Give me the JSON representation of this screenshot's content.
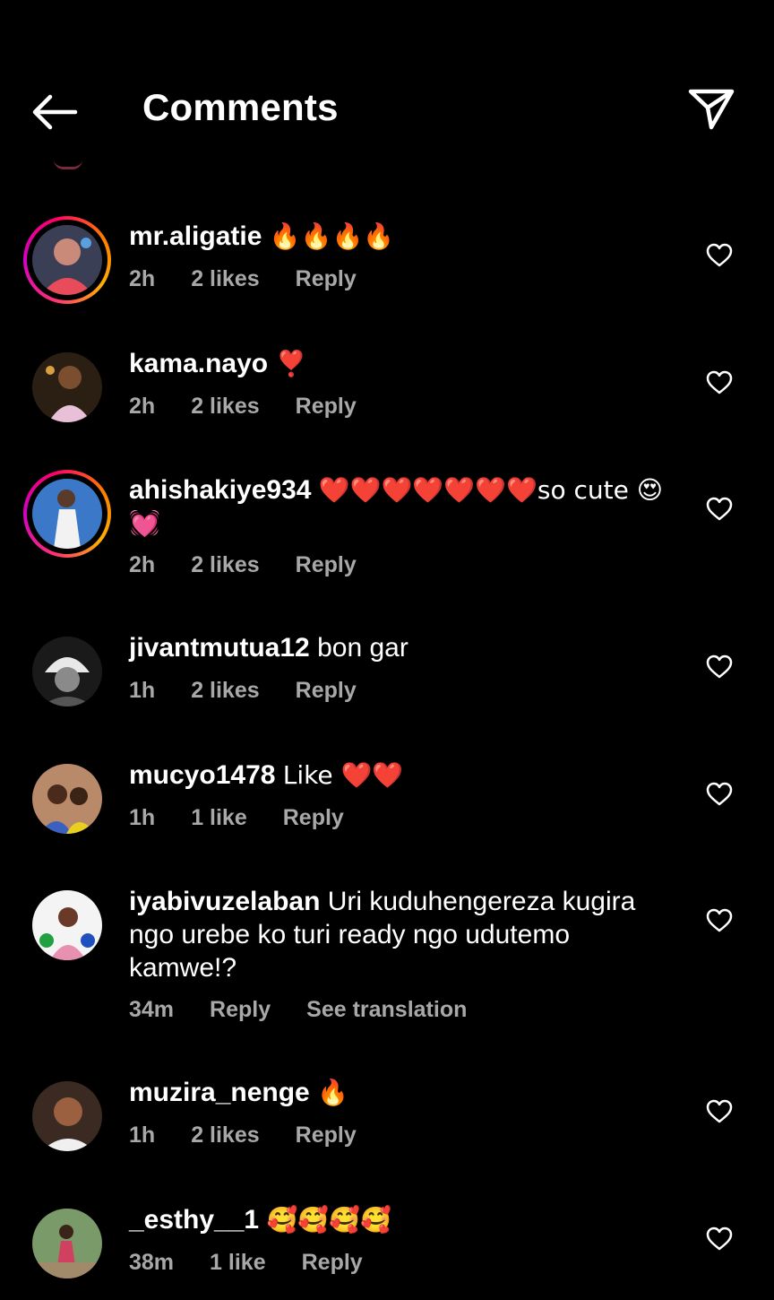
{
  "header": {
    "title": "Comments"
  },
  "icons": {
    "back": "arrow-left-icon",
    "share": "paper-plane-icon",
    "like": "heart-outline-icon"
  },
  "comments": [
    {
      "username": "mr.aligatie",
      "text": "🔥🔥🔥🔥",
      "time": "2h",
      "likes": "2 likes",
      "reply": "Reply",
      "story_ring": true
    },
    {
      "username": "kama.nayo",
      "text": "❣️",
      "time": "2h",
      "likes": "2 likes",
      "reply": "Reply",
      "story_ring": false
    },
    {
      "username": "ahishakiye934",
      "text": "❤️❤️❤️❤️❤️❤️❤️so cute 😍 💓",
      "time": "2h",
      "likes": "2 likes",
      "reply": "Reply",
      "story_ring": true
    },
    {
      "username": "jivantmutua12",
      "text": "bon gar",
      "time": "1h",
      "likes": "2 likes",
      "reply": "Reply",
      "story_ring": false
    },
    {
      "username": "mucyo1478",
      "text": "Like ❤️❤️",
      "time": "1h",
      "likes": "1 like",
      "reply": "Reply",
      "story_ring": false
    },
    {
      "username": "iyabivuzelaban",
      "text": "Uri kuduhengereza kugira ngo urebe ko turi ready ngo udutemo kamwe!?",
      "time": "34m",
      "reply": "Reply",
      "see_translation": "See translation",
      "story_ring": false
    },
    {
      "username": "muzira_nenge",
      "text": "🔥",
      "time": "1h",
      "likes": "2 likes",
      "reply": "Reply",
      "story_ring": false
    },
    {
      "username": "_esthy__1",
      "text": "🥰🥰🥰🥰",
      "time": "38m",
      "likes": "1 like",
      "reply": "Reply",
      "story_ring": false
    }
  ]
}
